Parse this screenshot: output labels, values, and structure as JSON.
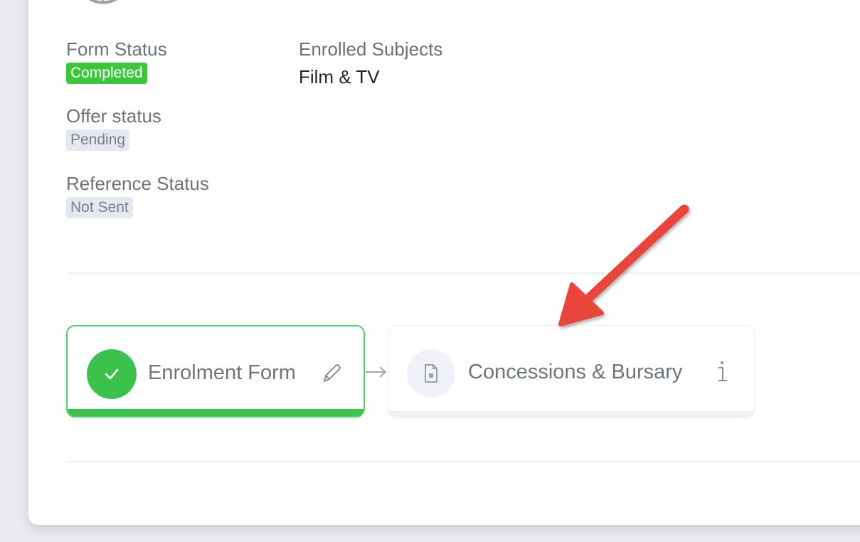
{
  "fields": {
    "form_status": {
      "label": "Form Status",
      "badge": "Completed"
    },
    "enrolled_subjects": {
      "label": "Enrolled Subjects",
      "value": "Film & TV"
    },
    "offer_status": {
      "label": "Offer status",
      "badge": "Pending"
    },
    "reference_status": {
      "label": "Reference Status",
      "badge": "Not Sent"
    }
  },
  "steps": [
    {
      "title": "Enrolment Form",
      "state": "completed",
      "action_icon": "pencil-icon"
    },
    {
      "title": "Concessions & Bursary",
      "state": "pending",
      "action_icon": "info-icon"
    }
  ],
  "colors": {
    "success": "#3cc24c",
    "annotation_arrow": "#e8453c",
    "badge_grey": "#e5e8ef"
  }
}
